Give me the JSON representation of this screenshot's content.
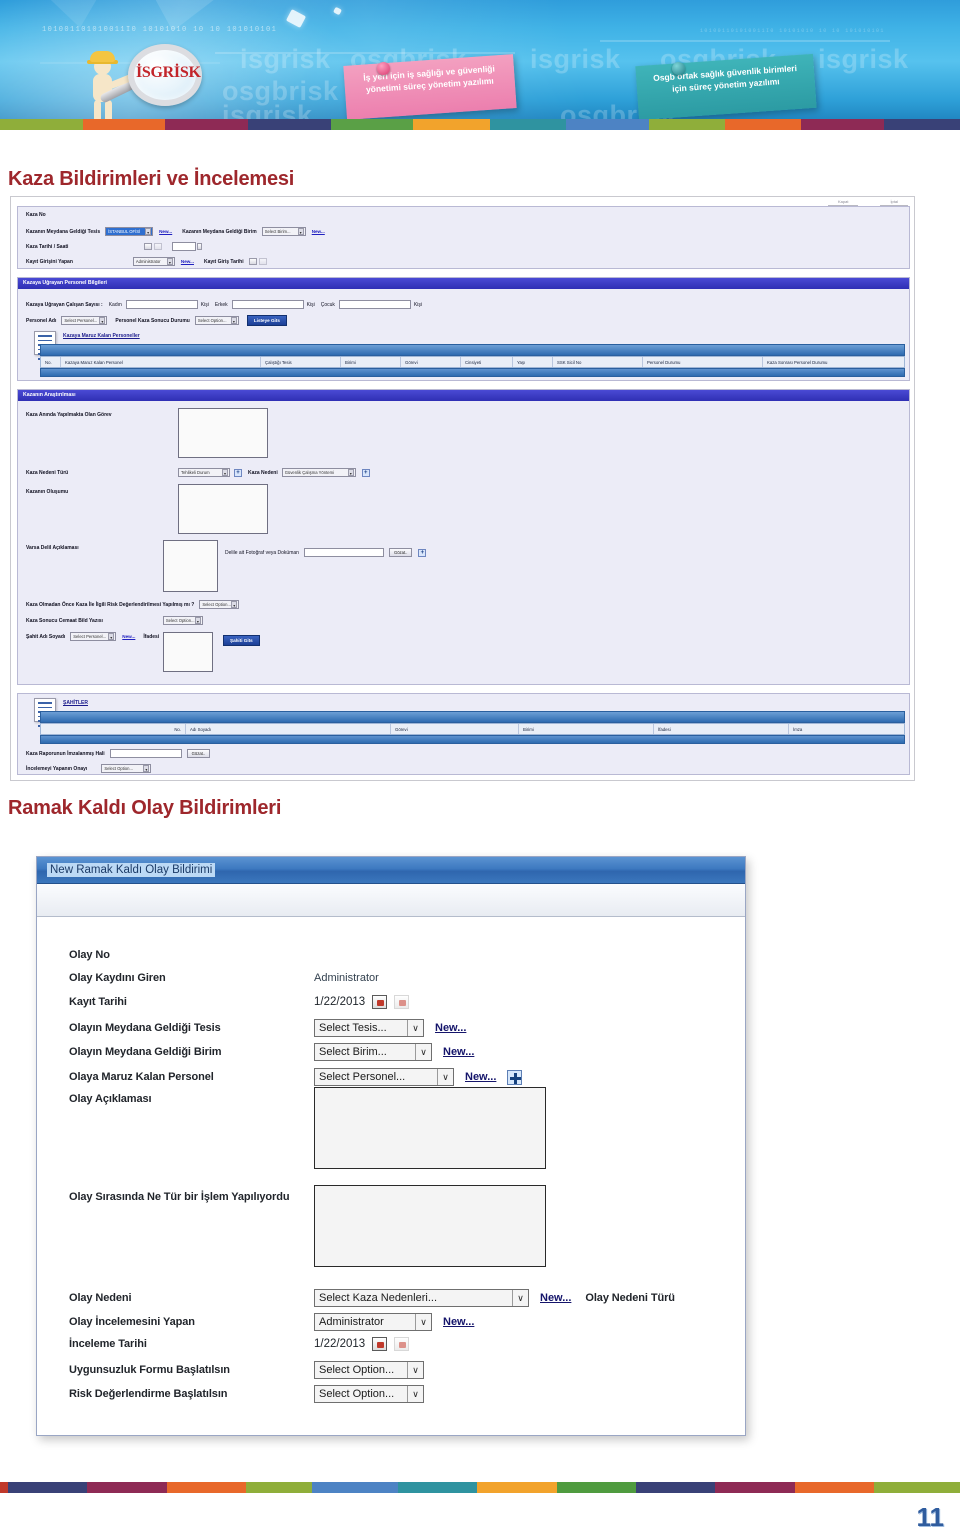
{
  "banner": {
    "logo_text": "İSGRİSK",
    "ghost_words": [
      "isgrisk",
      "osgbrisk",
      "isgrisk",
      "osgbrisk",
      "isgrisk",
      "osgbrisk",
      "isgrisk"
    ],
    "binary_text": "101001101010011I0   10101010   10 10  101010101",
    "note_pink": "İş yeri için iş sağlığı ve güvenliği yönetimi süreç yönetim yazılımı",
    "note_teal": "Osgb ortak sağlık güvenlik birimleri için süreç yönetim yazılımı",
    "strip_colors": [
      "#8fae3a",
      "#e8682a",
      "#8e2a55",
      "#394177",
      "#5aa046",
      "#f2a32c",
      "#2f93a0",
      "#4d83c4",
      "#8fae3a",
      "#e8682a",
      "#8e2a55",
      "#394177"
    ]
  },
  "sections": {
    "title1": "Kaza Bildirimleri ve İncelemesi",
    "title2": "Ramak Kaldı Olay Bildirimleri"
  },
  "shot1": {
    "toolbar": [
      "Kapat",
      "İptal"
    ],
    "accident_no_label": "Kaza No",
    "row_facility_label": "Kazanın Meydana Geldiği Tesis",
    "row_facility_value": "İSTANBUL OFİSİ",
    "row_unit_label": "Kazanın Meydana Geldiği Birim",
    "row_unit_value": "Select Birim...",
    "row_datetime_label": "Kaza Tarihi / Saati",
    "row_recorder_label": "Kayıt Girişini Yapan",
    "row_recorder_value": "Administrator",
    "row_recorddate_label": "Kayıt Giriş Tarihi",
    "new_link": "New...",
    "panel2_header": "Kazaya Uğrayan Personel Bilgileri",
    "p2_count_label": "Kazaya Uğrayan Çalışan Sayısı  :",
    "p2_kadin": "Kadın",
    "p2_erkek": "Erkek",
    "p2_cocuk": "Çocuk",
    "p2_kisi": "Kişi",
    "p2_personel_label": "Personel Adı",
    "p2_personel_value": "Select Personel...",
    "p2_durum_label": "Personel Kaza Sonucu Durumu",
    "p2_durum_value": "Select Option...",
    "p2_button": "Listeye Gits",
    "grid1_title": "Kazaya Maruz Kalan Personeller",
    "grid1_cols": [
      "No.",
      "Kazaya Maruz Kalan Personel",
      "Çalıştığı Tesis",
      "Birimi",
      "Görevi",
      "Cinsiyeti",
      "Yaşı",
      "SSK Sicil No",
      "Personel Durumu",
      "Kaza Sonrası Personel Durumu"
    ],
    "panel3_header": "Kazanın Araştırılması",
    "p3_gorev_label": "Kaza Anında Yapılmakta Olan Görev",
    "p3_nedenturu_label": "Kaza Nedeni Türü",
    "p3_nedenturu_value": "Tehlikeli Durum",
    "p3_neden_label": "Kaza Nedeni",
    "p3_neden_value": "Güvenlik Çalışma Yöntemi",
    "p3_olusumu_label": "Kazanın Oluşumu",
    "p3_delil_label": "Varsa Delil Açıklaması",
    "p3_dosya_label": "Delile ait Fotoğraf veya Doküman",
    "p3_gozat": "Gözat..",
    "p3_egitim_label": "Kaza Olmadan Önce Kaza İle İlgili Risk Değerlendirilmesi Yapılmış mı ?",
    "p3_egitim_value": "Select Option...",
    "p3_cemaat_label": "Kaza Sonucu Cemaat Bild Yazısı",
    "p3_cemaat_value": "Select Option...",
    "p3_sahit_label": "Şahit Adı Soyadı",
    "p3_sahit_value": "Select Personel...",
    "p3_ifade_label": "İfadesi",
    "p3_sahit_button": "Şahiti Gits",
    "grid2_title": "ŞAHİTLER",
    "grid2_cols": [
      "No.",
      "Adı Soyadı",
      "Görevi",
      "Birimi",
      "İfadesi",
      "İmza"
    ],
    "footer_rapor_label": "Kaza Raporunun İmzalanmış Hali",
    "footer_rapor_btn": "Gözat..",
    "footer_onay_label": "İncelemeyi Yapanın Onayı",
    "footer_onay_value": "Select Option..."
  },
  "shot2": {
    "window_title": "New Ramak Kaldı Olay Bildirimi",
    "fields": [
      {
        "label": "Olay No",
        "type": "empty"
      },
      {
        "label": "Olay Kaydını Giren",
        "type": "text",
        "value": "Administrator"
      },
      {
        "label": "Kayıt Tarihi",
        "type": "date",
        "value": "1/22/2013"
      },
      {
        "label": "Olayın Meydana Geldiği Tesis",
        "type": "select",
        "value": "Select Tesis...",
        "link": "New..."
      },
      {
        "label": "Olayın Meydana Geldiği Birim",
        "type": "select",
        "value": "Select Birim...",
        "link": "New..."
      },
      {
        "label": "Olaya Maruz Kalan Personel",
        "type": "select",
        "value": "Select Personel...",
        "link": "New...",
        "plus": true
      },
      {
        "label": "Olay Açıklaması",
        "type": "textarea"
      },
      {
        "label": "Olay Sırasında Ne Tür bir İşlem Yapılıyordu",
        "type": "textarea"
      },
      {
        "label": "Olay Nedeni",
        "type": "select",
        "value": "Select Kaza Nedenleri...",
        "link": "New...",
        "extra": "Olay Nedeni Türü"
      },
      {
        "label": "Olay İncelemesini Yapan",
        "type": "select",
        "value": "Administrator",
        "link": "New..."
      },
      {
        "label": "İnceleme Tarihi",
        "type": "date",
        "value": "1/22/2013"
      },
      {
        "label": "Uygunsuzluk Formu Başlatılsın",
        "type": "select",
        "value": "Select Option..."
      },
      {
        "label": "Risk Değerlendirme Başlatılsın",
        "type": "select",
        "value": "Select Option..."
      }
    ]
  },
  "footer": {
    "page_number": "11",
    "strip_colors": [
      "#c0392b",
      "#394177",
      "#8e2a55",
      "#e8682a",
      "#8fae3a",
      "#4d83c4",
      "#2f93a0",
      "#f2a32c",
      "#4f9b3f",
      "#394177",
      "#8e2a55",
      "#e8682a",
      "#8fae3a"
    ]
  }
}
